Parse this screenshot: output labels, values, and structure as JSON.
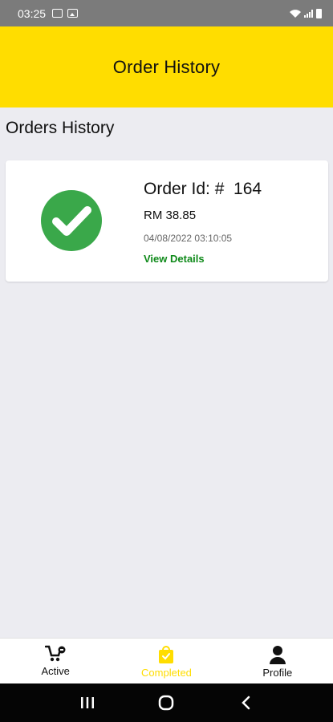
{
  "status_bar": {
    "time": "03:25"
  },
  "header": {
    "title": "Order History"
  },
  "section": {
    "title": "Orders History"
  },
  "orders": [
    {
      "order_id": "Order Id: #  164",
      "amount": "RM 38.85",
      "date": "04/08/2022 03:10:05",
      "action": "View Details",
      "status_icon": "check-circle-icon"
    }
  ],
  "bottom_nav": {
    "items": [
      {
        "label": "Active",
        "icon": "cart-icon"
      },
      {
        "label": "Completed",
        "icon": "shopping-bag-icon",
        "active": true
      },
      {
        "label": "Profile",
        "icon": "person-icon"
      }
    ]
  },
  "colors": {
    "header": "#ffdd00",
    "success": "#3aa84a",
    "link": "#0f8a1a",
    "active_tab": "#ffdd00"
  }
}
